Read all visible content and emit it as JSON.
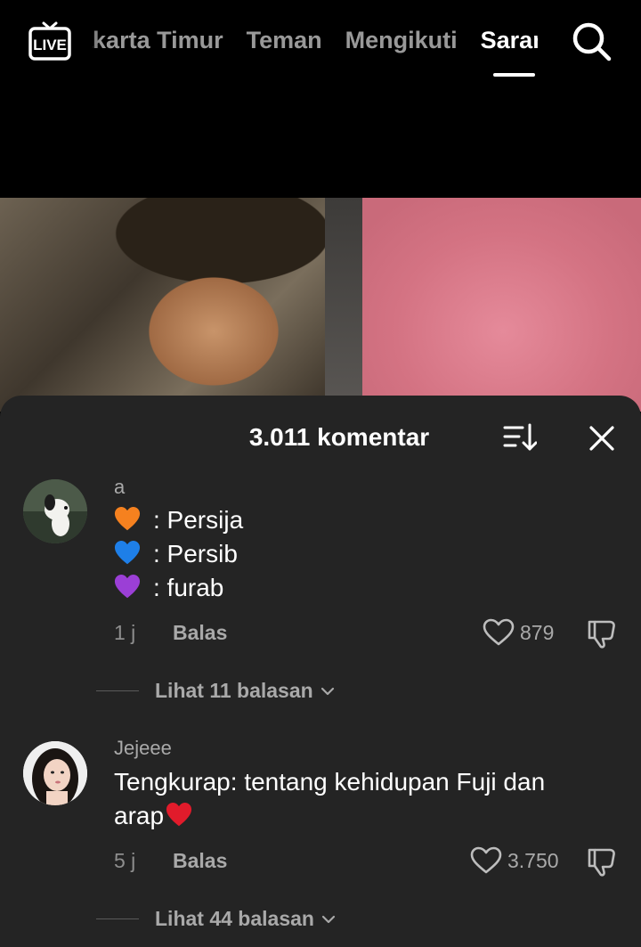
{
  "topbar": {
    "live_label": "LIVE",
    "tabs": [
      {
        "label": "Jakarta Timur",
        "visible": "ung Timur"
      },
      {
        "label": "Teman"
      },
      {
        "label": "Mengikuti"
      },
      {
        "label": "Saran",
        "active": true
      }
    ]
  },
  "sheet": {
    "title": "3.011 komentar"
  },
  "comments": [
    {
      "username": "a",
      "lines": [
        {
          "emoji": "orange-heart",
          "color": "#f5811f",
          "text": ": Persija"
        },
        {
          "emoji": "blue-heart",
          "color": "#1e7fe8",
          "text": ": Persib"
        },
        {
          "emoji": "purple-heart",
          "color": "#9b3fd6",
          "text": ": furab"
        }
      ],
      "time": "1 j",
      "reply_label": "Balas",
      "likes": "879",
      "view_replies": "Lihat 11 balasan"
    },
    {
      "username": "Jejeee",
      "text_line1": "Tengkurap: tentang kehidupan Fuji dan",
      "text_line2": "arap",
      "emoji": {
        "name": "red-heart",
        "color": "#e11b2b"
      },
      "time": "5 j",
      "reply_label": "Balas",
      "likes": "3.750",
      "view_replies": "Lihat 44 balasan"
    }
  ],
  "colors": {
    "sheet_bg": "#242424",
    "muted_text": "#a9a9a9",
    "background": "#000000"
  }
}
